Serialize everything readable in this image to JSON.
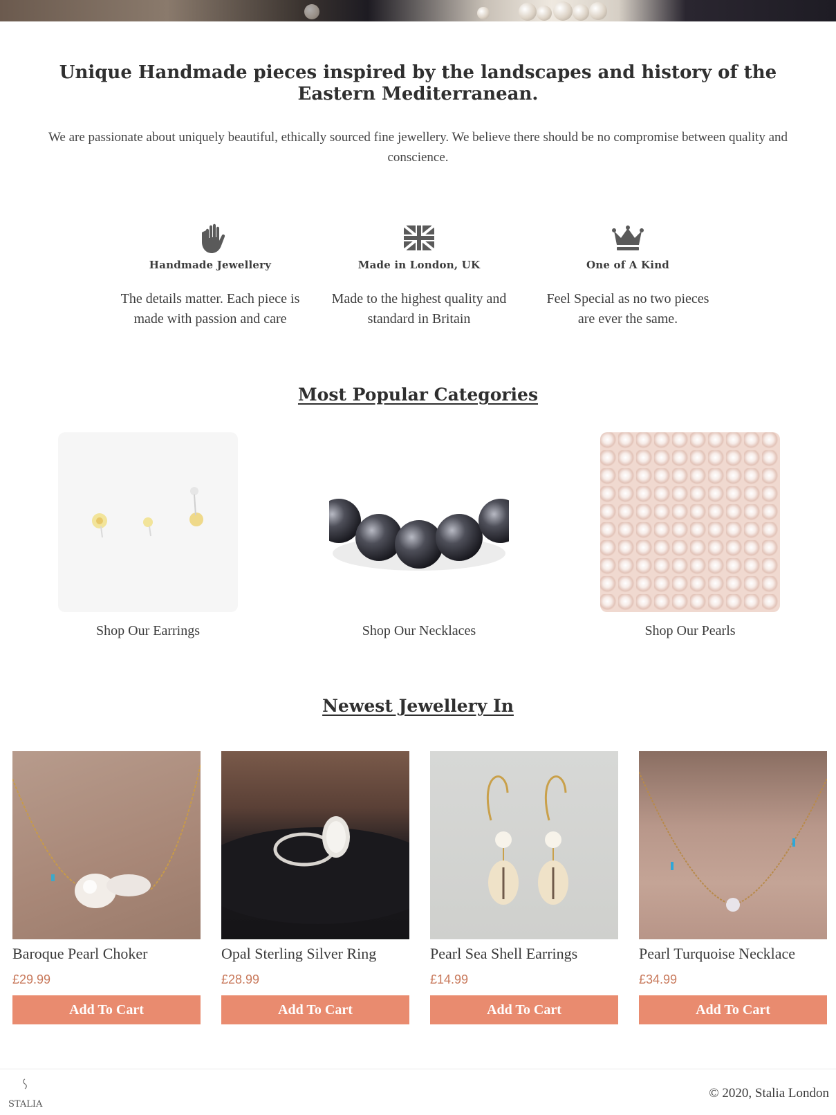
{
  "hero": {
    "alt": "pearls banner"
  },
  "intro": {
    "headline": "Unique Handmade pieces inspired by the landscapes and history of the Eastern Mediterranean.",
    "text": "We are passionate about uniquely beautiful, ethically sourced fine jewellery. We believe there should be no compromise between quality and conscience."
  },
  "features": [
    {
      "icon": "hand-icon",
      "title": "Handmade Jewellery",
      "text": "The details matter. Each piece is made with passion and care"
    },
    {
      "icon": "uk-flag-icon",
      "title": "Made in London, UK",
      "text": "Made to the highest quality and standard in Britain"
    },
    {
      "icon": "crown-icon",
      "title": "One of A Kind",
      "text": "Feel Special as no two pieces are ever the same."
    }
  ],
  "categories": {
    "title": "Most Popular Categories",
    "items": [
      {
        "label": "Shop Our Earrings"
      },
      {
        "label": "Shop Our Necklaces"
      },
      {
        "label": "Shop Our Pearls"
      }
    ]
  },
  "newest": {
    "title": "Newest Jewellery In",
    "products": [
      {
        "name": "Baroque Pearl Choker",
        "price": "£29.99",
        "button": "Add To Cart"
      },
      {
        "name": "Opal Sterling Silver Ring",
        "price": "£28.99",
        "button": "Add To Cart"
      },
      {
        "name": "Pearl Sea Shell Earrings",
        "price": "£14.99",
        "button": "Add To Cart"
      },
      {
        "name": "Pearl Turquoise Necklace",
        "price": "£34.99",
        "button": "Add To Cart"
      }
    ]
  },
  "footer": {
    "logo_text": "STALIA",
    "copyright": "© 2020, Stalia London"
  },
  "colors": {
    "accent": "#e98b6f",
    "price": "#c8785a",
    "text": "#3a3a3a"
  }
}
